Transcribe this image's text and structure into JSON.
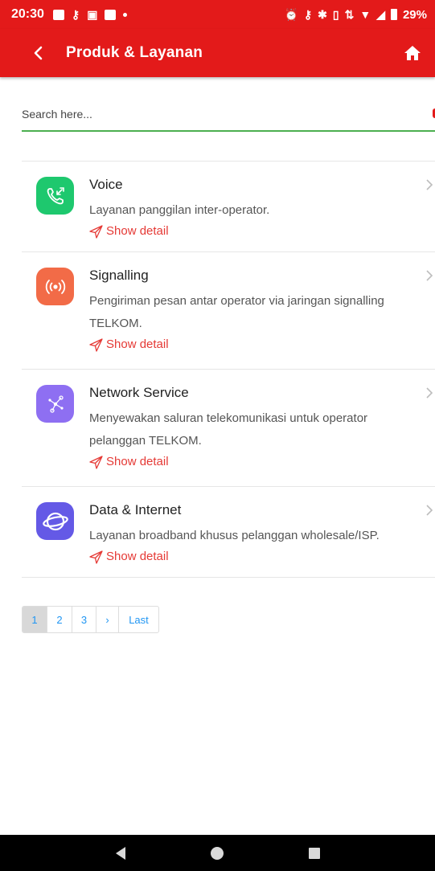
{
  "status_bar": {
    "time": "20:30",
    "battery": "29%"
  },
  "app_bar": {
    "title": "Produk & Layanan"
  },
  "search": {
    "placeholder": "Search here..."
  },
  "items": [
    {
      "title": "Voice",
      "description": "Layanan panggilan inter-operator.",
      "link": "Show detail",
      "icon": "phone-call-icon",
      "color": "#1ec86e"
    },
    {
      "title": "Signalling",
      "description": "Pengiriman pesan antar operator via jaringan signalling TELKOM.",
      "link": "Show detail",
      "icon": "signal-broadcast-icon",
      "color": "#f26b47"
    },
    {
      "title": "Network Service",
      "description": "Menyewakan saluran telekomunikasi untuk operator pelanggan TELKOM.",
      "link": "Show detail",
      "icon": "network-nodes-icon",
      "color": "#8e6ff2"
    },
    {
      "title": "Data & Internet",
      "description": "Layanan broadband khusus pelanggan wholesale/ISP.",
      "link": "Show detail",
      "icon": "planet-icon",
      "color": "#6459e6"
    }
  ],
  "pagination": {
    "pages": [
      "1",
      "2",
      "3"
    ],
    "next": "›",
    "last": "Last",
    "active": "1"
  },
  "colors": {
    "primary": "#e31a1a",
    "link": "#e53935",
    "search_underline": "#4caf50",
    "page_link": "#2196f3"
  }
}
